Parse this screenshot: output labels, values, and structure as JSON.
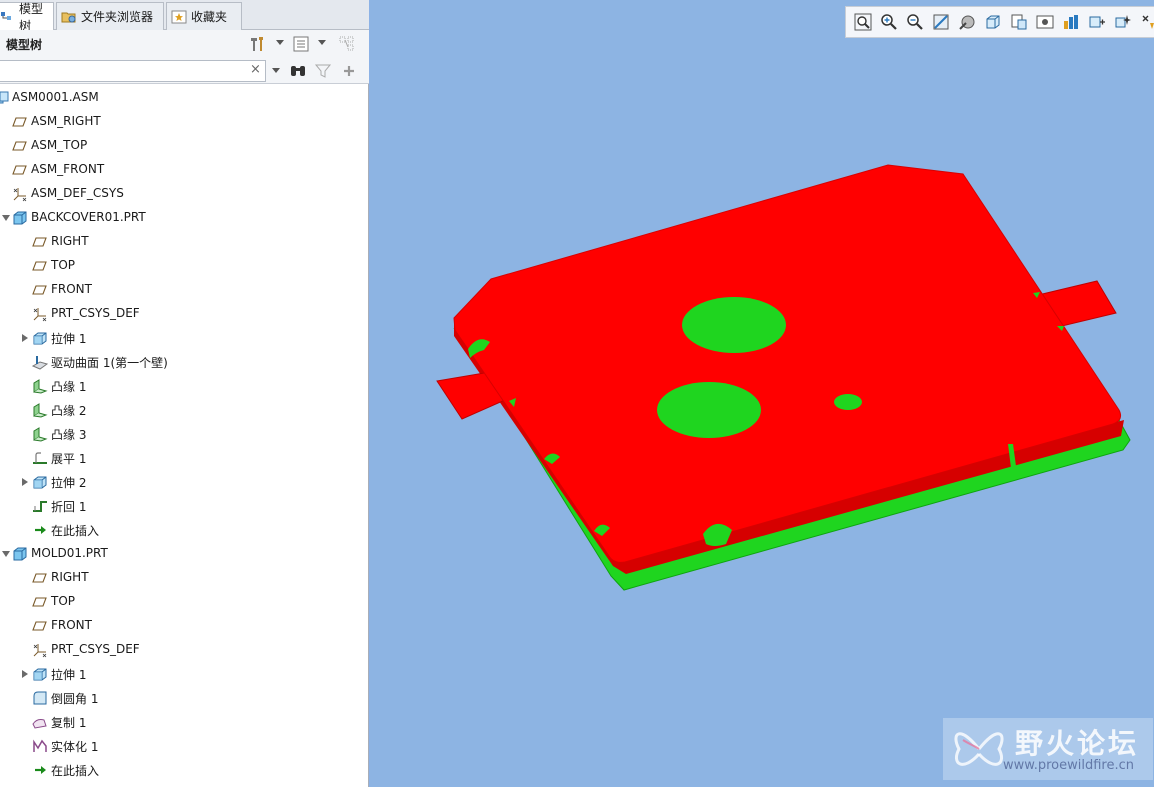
{
  "tabs": [
    {
      "label": "模型树",
      "icon": "model-tree-tab-icon",
      "active": true
    },
    {
      "label": "文件夹浏览器",
      "icon": "folder-tab-icon",
      "active": false
    },
    {
      "label": "收藏夹",
      "icon": "favorites-tab-icon",
      "active": false
    }
  ],
  "panel": {
    "title": "模型树",
    "header_icons": [
      "settings-tools-icon",
      "dropdown-icon",
      "show-columns-icon",
      "dropdown-icon",
      "tree-filter-disabled-icon"
    ]
  },
  "search": {
    "value": "",
    "placeholder": "",
    "clear": "×",
    "icons": [
      "search-dropdown-icon",
      "find-binoculars-icon",
      "filter-icon",
      "add-icon"
    ]
  },
  "tree": [
    {
      "label": "ASM0001.ASM",
      "icon": "assembly-icon",
      "level": 0,
      "expander": "none"
    },
    {
      "label": "ASM_RIGHT",
      "icon": "datum-plane-icon",
      "level": 1,
      "expander": "none"
    },
    {
      "label": "ASM_TOP",
      "icon": "datum-plane-icon",
      "level": 1,
      "expander": "none"
    },
    {
      "label": "ASM_FRONT",
      "icon": "datum-plane-icon",
      "level": 1,
      "expander": "none"
    },
    {
      "label": "ASM_DEF_CSYS",
      "icon": "csys-icon",
      "level": 1,
      "expander": "none"
    },
    {
      "label": "BACKCOVER01.PRT",
      "icon": "part-icon",
      "level": 1,
      "expander": "down"
    },
    {
      "label": "RIGHT",
      "icon": "datum-plane-icon",
      "level": 2,
      "expander": "none"
    },
    {
      "label": "TOP",
      "icon": "datum-plane-icon",
      "level": 2,
      "expander": "none"
    },
    {
      "label": "FRONT",
      "icon": "datum-plane-icon",
      "level": 2,
      "expander": "none"
    },
    {
      "label": "PRT_CSYS_DEF",
      "icon": "csys-icon",
      "level": 2,
      "expander": "none"
    },
    {
      "label": "拉伸 1",
      "icon": "extrude-icon",
      "level": 2,
      "expander": "right"
    },
    {
      "label": "驱动曲面 1(第一个壁)",
      "icon": "driving-surface-icon",
      "level": 2,
      "expander": "none"
    },
    {
      "label": "凸缘 1",
      "icon": "flange-icon",
      "level": 2,
      "expander": "none"
    },
    {
      "label": "凸缘 2",
      "icon": "flange-icon",
      "level": 2,
      "expander": "none"
    },
    {
      "label": "凸缘 3",
      "icon": "flange-icon",
      "level": 2,
      "expander": "none"
    },
    {
      "label": "展平 1",
      "icon": "unbend-icon",
      "level": 2,
      "expander": "none"
    },
    {
      "label": "拉伸 2",
      "icon": "extrude-icon",
      "level": 2,
      "expander": "right"
    },
    {
      "label": "折回 1",
      "icon": "bend-back-icon",
      "level": 2,
      "expander": "none"
    },
    {
      "label": "在此插入",
      "icon": "insert-here-arrow-icon",
      "level": 2,
      "expander": "none"
    },
    {
      "label": "MOLD01.PRT",
      "icon": "part-icon",
      "level": 1,
      "expander": "down"
    },
    {
      "label": "RIGHT",
      "icon": "datum-plane-icon",
      "level": 2,
      "expander": "none"
    },
    {
      "label": "TOP",
      "icon": "datum-plane-icon",
      "level": 2,
      "expander": "none"
    },
    {
      "label": "FRONT",
      "icon": "datum-plane-icon",
      "level": 2,
      "expander": "none"
    },
    {
      "label": "PRT_CSYS_DEF",
      "icon": "csys-icon",
      "level": 2,
      "expander": "none"
    },
    {
      "label": "拉伸 1",
      "icon": "extrude-icon",
      "level": 2,
      "expander": "right"
    },
    {
      "label": "倒圆角 1",
      "icon": "round-icon",
      "level": 2,
      "expander": "none"
    },
    {
      "label": "复制 1",
      "icon": "copy-surface-icon",
      "level": 2,
      "expander": "none"
    },
    {
      "label": "实体化 1",
      "icon": "solidify-icon",
      "level": 2,
      "expander": "none"
    },
    {
      "label": "在此插入",
      "icon": "insert-here-arrow-icon",
      "level": 2,
      "expander": "none"
    }
  ],
  "view_toolbar": [
    "zoom-fit-icon",
    "zoom-in-icon",
    "zoom-out-icon",
    "repaint-icon",
    "display-style-icon",
    "saved-orientations-icon",
    "view-manager-icon",
    "perspective-icon",
    "annotation-display-icon",
    "datum-display-icon",
    "spin-center-icon",
    "more-tools-icon"
  ],
  "viewport": {
    "background": "#8db4e3",
    "cover_color": "#ff0000",
    "mold_color": "#1fd51f"
  },
  "watermark": {
    "title": "野火论坛",
    "url": "www.proewildfire.cn"
  }
}
